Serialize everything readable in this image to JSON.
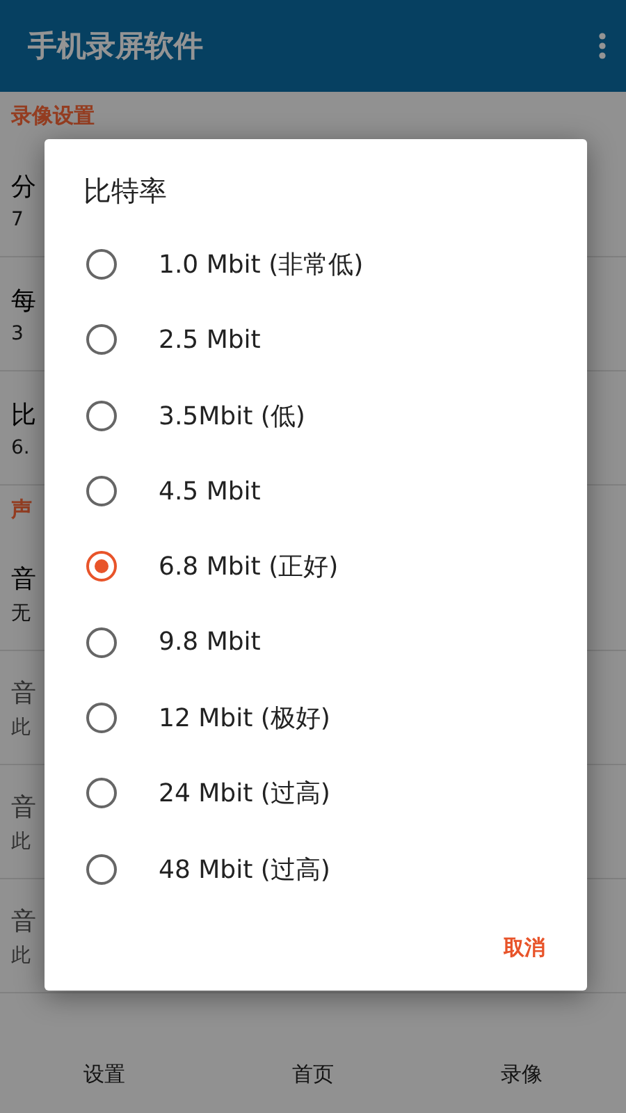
{
  "app_bar": {
    "title": "手机录屏软件"
  },
  "settings": [
    {
      "kind": "header",
      "title": "录像设置"
    },
    {
      "kind": "row",
      "title": "分",
      "summary": "7",
      "disabled": false
    },
    {
      "kind": "row",
      "title": "每",
      "summary": "3",
      "disabled": false
    },
    {
      "kind": "row",
      "title": "比",
      "summary": "6.",
      "disabled": false
    },
    {
      "kind": "header",
      "title": "声"
    },
    {
      "kind": "row",
      "title": "音",
      "summary": "无",
      "disabled": false
    },
    {
      "kind": "row",
      "title": "音",
      "summary": "此",
      "disabled": true
    },
    {
      "kind": "row",
      "title": "音",
      "summary": "此",
      "disabled": true
    },
    {
      "kind": "row",
      "title": "音",
      "summary": "此",
      "disabled": true
    }
  ],
  "dialog": {
    "title": "比特率",
    "options": [
      {
        "label": "1.0 Mbit (非常低)",
        "selected": false
      },
      {
        "label": "2.5 Mbit",
        "selected": false
      },
      {
        "label": "3.5Mbit (低)",
        "selected": false
      },
      {
        "label": "4.5 Mbit",
        "selected": false
      },
      {
        "label": "6.8 Mbit (正好)",
        "selected": true
      },
      {
        "label": "9.8 Mbit",
        "selected": false
      },
      {
        "label": "12 Mbit (极好)",
        "selected": false
      },
      {
        "label": "24 Mbit (过高)",
        "selected": false
      },
      {
        "label": "48 Mbit (过高)",
        "selected": false
      }
    ],
    "cancel": "取消"
  },
  "bottom_nav": [
    {
      "label": "设置"
    },
    {
      "label": "首页"
    },
    {
      "label": "录像"
    }
  ]
}
